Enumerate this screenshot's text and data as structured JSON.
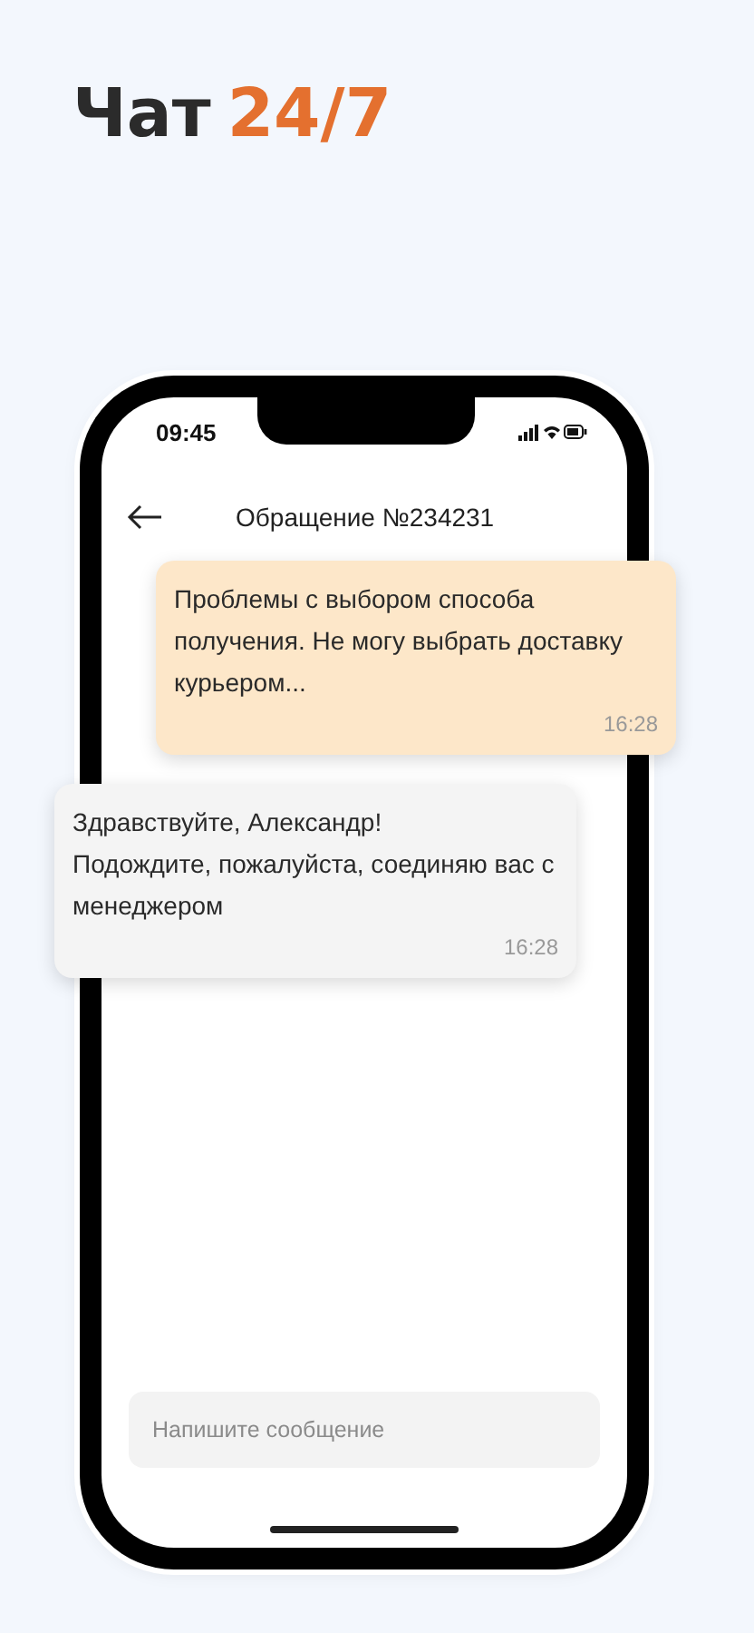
{
  "headline": {
    "text": "Чат",
    "accent": "24/7"
  },
  "status_bar": {
    "time": "09:45"
  },
  "header": {
    "title": "Обращение №234231"
  },
  "messages": [
    {
      "kind": "outgoing",
      "text": "Проблемы с выбором способа получения. Не могу выбрать доставку курьером...",
      "time": "16:28"
    },
    {
      "kind": "incoming",
      "text": "Здравствуйте, Александр!\nПодождите, пожалуйста, соединяю вас с менеджером",
      "time": "16:28"
    }
  ],
  "composer": {
    "placeholder": "Напишите сообщение"
  }
}
